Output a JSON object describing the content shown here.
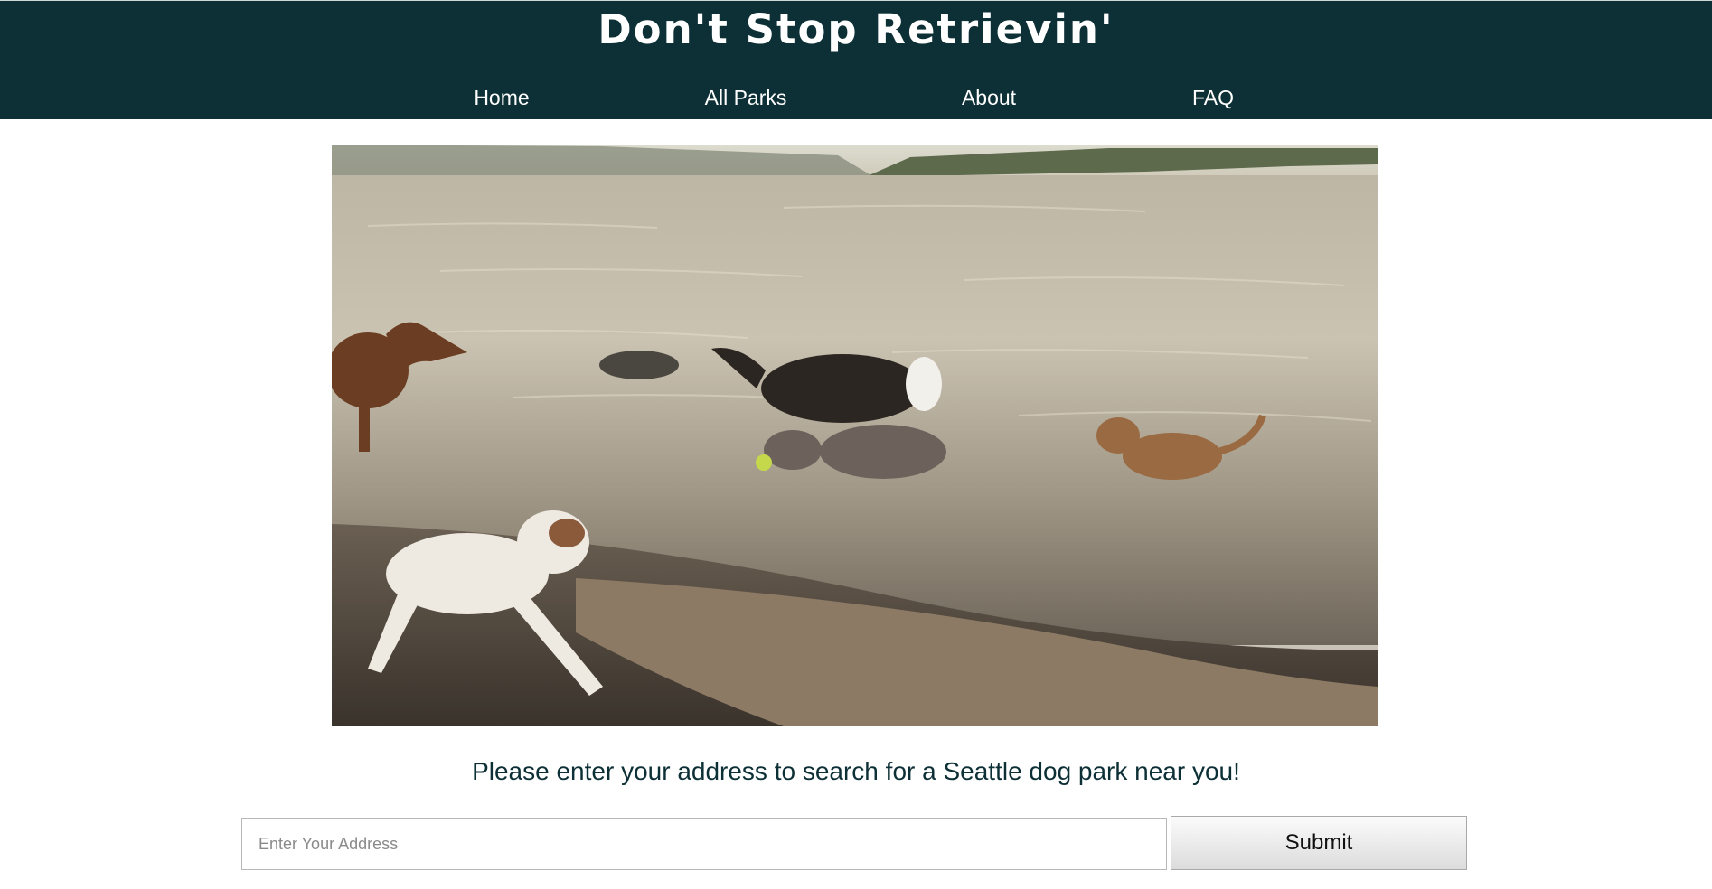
{
  "header": {
    "title": "Don't Stop Retrievin'",
    "background": "#0d3036",
    "nav": {
      "home": "Home",
      "all_parks": "All Parks",
      "about": "About",
      "faq": "FAQ"
    }
  },
  "main": {
    "prompt": "Please enter your address to search for a Seattle dog park near you!",
    "search": {
      "placeholder": "Enter Your Address",
      "value": "",
      "submit_label": "Submit"
    }
  }
}
